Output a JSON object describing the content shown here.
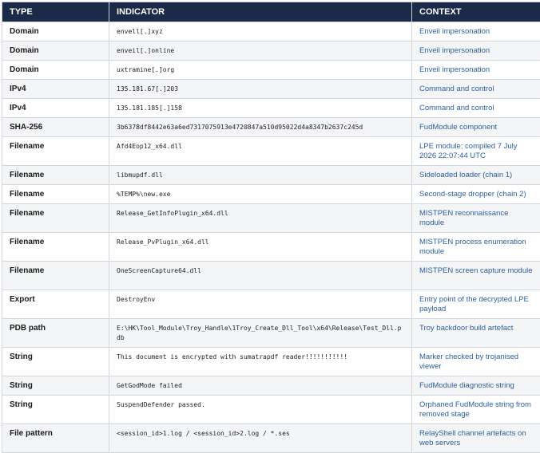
{
  "headers": {
    "type": "TYPE",
    "indicator": "INDICATOR",
    "context": "CONTEXT"
  },
  "rows": [
    {
      "type": "Domain",
      "indicator": "envell[.]xyz",
      "context": "Enveil impersonation"
    },
    {
      "type": "Domain",
      "indicator": "enveil[.]online",
      "context": "Enveil impersonation"
    },
    {
      "type": "Domain",
      "indicator": "uxtramine[.]org",
      "context": "Enveil impersonation"
    },
    {
      "type": "IPv4",
      "indicator": "135.181.67[.]203",
      "context": "Command and control"
    },
    {
      "type": "IPv4",
      "indicator": "135.181.185[.]158",
      "context": "Command and control"
    },
    {
      "type": "SHA-256",
      "indicator": "3b6378df8442e63a6ed7317075913e4720847a510d95022d4a8347b2637c245d",
      "context": "FudModule component"
    },
    {
      "type": "Filename",
      "indicator": "Afd4Eop12_x64.dll",
      "context": "LPE module; compiled 7 July 2026 22:07:44 UTC"
    },
    {
      "type": "Filename",
      "indicator": "libmupdf.dll",
      "context": "Sideloaded loader (chain 1)"
    },
    {
      "type": "Filename",
      "indicator": "%TEMP%\\new.exe",
      "context": "Second-stage dropper (chain 2)"
    },
    {
      "type": "Filename",
      "indicator": "Release_GetInfoPlugin_x64.dll",
      "context": "MISTPEN reconnaissance module"
    },
    {
      "type": "Filename",
      "indicator": "Release_PvPlugin_x64.dll",
      "context": "MISTPEN process enumeration module"
    },
    {
      "type": "Filename",
      "indicator": "OneScreenCapture64.dll",
      "context": "MISTPEN screen capture module"
    },
    {
      "type": "Export",
      "indicator": "DestroyEnv",
      "context": "Entry point of the decrypted LPE payload"
    },
    {
      "type": "PDB path",
      "indicator": "E:\\HK\\Tool_Module\\Troy_Handle\\1Troy_Create_Dll_Tool\\x64\\Release\\Test_Dll.pdb",
      "context": "Troy backdoor build artefact"
    },
    {
      "type": "String",
      "indicator": "This document is encrypted with sumatrapdf reader!!!!!!!!!!!",
      "context": "Marker checked by trojanised viewer"
    },
    {
      "type": "String",
      "indicator": "GetGodMode failed",
      "context": "FudModule diagnostic string"
    },
    {
      "type": "String",
      "indicator": "SuspendDefender passed.",
      "context": "Orphaned FudModule string from removed stage"
    },
    {
      "type": "File pattern",
      "indicator": "<session_id>1.log / <session_id>2.log / *.ses",
      "context": "RelayShell channel artefacts on web servers"
    }
  ]
}
